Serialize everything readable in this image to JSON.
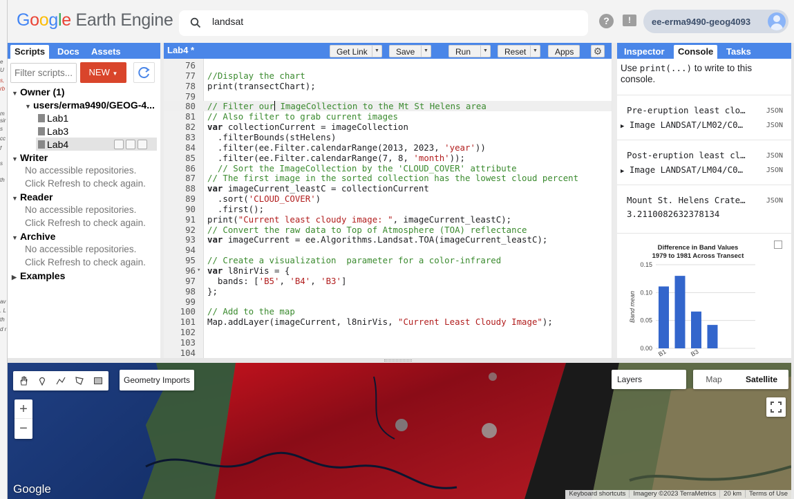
{
  "app": {
    "logo_google": [
      "G",
      "o",
      "o",
      "g",
      "l",
      "e"
    ],
    "logo_rest": "Earth Engine",
    "search_value": "landsat",
    "account": "ee-erma9490-geog4093",
    "help": "?",
    "feedback": "!"
  },
  "left": {
    "tabs": [
      "Scripts",
      "Docs",
      "Assets"
    ],
    "filter_placeholder": "Filter scripts...",
    "new_label": "NEW",
    "tree": {
      "owner": "Owner (1)",
      "repo": "users/erma9490/GEOG-4...",
      "files": [
        "Lab1",
        "Lab3",
        "Lab4"
      ],
      "writer": "Writer",
      "reader": "Reader",
      "archive": "Archive",
      "examples": "Examples",
      "no_repos": "No accessible repositories.",
      "refresh_hint": "Click Refresh to check again."
    }
  },
  "editor": {
    "title": "Lab4 *",
    "buttons": {
      "get_link": "Get Link",
      "save": "Save",
      "run": "Run",
      "reset": "Reset",
      "apps": "Apps"
    },
    "lines": [
      {
        "n": "76",
        "segs": []
      },
      {
        "n": "77",
        "segs": [
          {
            "c": "cm",
            "t": "//Display the chart"
          }
        ]
      },
      {
        "n": "78",
        "segs": [
          {
            "c": "",
            "t": "print(transectChart);"
          }
        ]
      },
      {
        "n": "79",
        "segs": []
      },
      {
        "n": "80",
        "active": true,
        "segs": [
          {
            "c": "cm",
            "t": "// Filter our"
          },
          {
            "c": "cursor",
            "t": ""
          },
          {
            "c": "cm",
            "t": " ImageCollection to the Mt St Helens area"
          }
        ]
      },
      {
        "n": "81",
        "segs": [
          {
            "c": "cm",
            "t": "// Also filter to grab current images"
          }
        ]
      },
      {
        "n": "82",
        "segs": [
          {
            "c": "kw",
            "t": "var"
          },
          {
            "c": "",
            "t": " collectionCurrent = imageCollection"
          }
        ]
      },
      {
        "n": "83",
        "segs": [
          {
            "c": "",
            "t": "  .filterBounds(stHelens)"
          }
        ]
      },
      {
        "n": "84",
        "segs": [
          {
            "c": "",
            "t": "  .filter(ee.Filter.calendarRange(2013, 2023, "
          },
          {
            "c": "st",
            "t": "'year'"
          },
          {
            "c": "",
            "t": "))"
          }
        ]
      },
      {
        "n": "85",
        "segs": [
          {
            "c": "",
            "t": "  .filter(ee.Filter.calendarRange(7, 8, "
          },
          {
            "c": "st",
            "t": "'month'"
          },
          {
            "c": "",
            "t": "));"
          }
        ]
      },
      {
        "n": "86",
        "segs": [
          {
            "c": "cm",
            "t": "  // Sort the ImageCollection by the 'CLOUD_COVER' attribute"
          }
        ]
      },
      {
        "n": "87",
        "segs": [
          {
            "c": "cm",
            "t": "// The first image in the sorted collection has the lowest cloud percent"
          }
        ]
      },
      {
        "n": "88",
        "segs": [
          {
            "c": "kw",
            "t": "var"
          },
          {
            "c": "",
            "t": " imageCurrent_leastC = collectionCurrent"
          }
        ]
      },
      {
        "n": "89",
        "segs": [
          {
            "c": "",
            "t": "  .sort("
          },
          {
            "c": "st",
            "t": "'CLOUD_COVER'"
          },
          {
            "c": "",
            "t": ")"
          }
        ]
      },
      {
        "n": "90",
        "segs": [
          {
            "c": "",
            "t": "  .first();"
          }
        ]
      },
      {
        "n": "91",
        "segs": [
          {
            "c": "",
            "t": "print("
          },
          {
            "c": "st",
            "t": "\"Current least cloudy image: \""
          },
          {
            "c": "",
            "t": ", imageCurrent_leastC);"
          }
        ]
      },
      {
        "n": "92",
        "segs": [
          {
            "c": "cm",
            "t": "// Convert the raw data to Top of Atmosphere (TOA) reflectance"
          }
        ]
      },
      {
        "n": "93",
        "segs": [
          {
            "c": "kw",
            "t": "var"
          },
          {
            "c": "",
            "t": " imageCurrent = ee.Algorithms.Landsat.TOA(imageCurrent_leastC);"
          }
        ]
      },
      {
        "n": "94",
        "segs": []
      },
      {
        "n": "95",
        "segs": [
          {
            "c": "cm",
            "t": "// Create a visualization  parameter for a color-infrared"
          }
        ]
      },
      {
        "n": "96",
        "fold": true,
        "segs": [
          {
            "c": "kw",
            "t": "var"
          },
          {
            "c": "",
            "t": " l8nirVis = {"
          }
        ]
      },
      {
        "n": "97",
        "segs": [
          {
            "c": "",
            "t": "  bands: ["
          },
          {
            "c": "st",
            "t": "'B5'"
          },
          {
            "c": "",
            "t": ", "
          },
          {
            "c": "st",
            "t": "'B4'"
          },
          {
            "c": "",
            "t": ", "
          },
          {
            "c": "st",
            "t": "'B3'"
          },
          {
            "c": "",
            "t": "]"
          }
        ]
      },
      {
        "n": "98",
        "segs": [
          {
            "c": "",
            "t": "};"
          }
        ]
      },
      {
        "n": "99",
        "segs": []
      },
      {
        "n": "100",
        "segs": [
          {
            "c": "cm",
            "t": "// Add to the map"
          }
        ]
      },
      {
        "n": "101",
        "segs": [
          {
            "c": "",
            "t": "Map.addLayer(imageCurrent, l8nirVis, "
          },
          {
            "c": "st",
            "t": "\"Current Least Cloudy Image\""
          },
          {
            "c": "",
            "t": ");"
          }
        ]
      },
      {
        "n": "102",
        "segs": []
      },
      {
        "n": "103",
        "segs": []
      },
      {
        "n": "104",
        "segs": []
      }
    ]
  },
  "right": {
    "tabs": [
      "Inspector",
      "Console",
      "Tasks"
    ],
    "intro_pre": "Use ",
    "intro_code": "print(...)",
    "intro_post": " to write to this console.",
    "outputs": [
      {
        "line1": "Pre-eruption least clo…",
        "line2": "Image LANDSAT/LM02/C0…",
        "tag": "JSON"
      },
      {
        "line1": "Post-eruption least cl…",
        "line2": "Image LANDSAT/LM04/C0…",
        "tag": "JSON"
      },
      {
        "line1": "Mount St. Helens Crate…",
        "line2": "3.2110082632378134",
        "tag": "JSON",
        "value_only": true
      }
    ]
  },
  "chart_data": {
    "type": "bar",
    "title": "Difference in Band Values 1979 to 1981 Across Transect",
    "ylabel": "Band mean",
    "xlabel": "",
    "ylim": [
      0,
      0.15
    ],
    "yticks": [
      "0.15",
      "0.10",
      "0.05",
      "0.00"
    ],
    "xtick_fragments": [
      "B1",
      "B3"
    ],
    "values": [
      0.111,
      0.13,
      0.066,
      0.042
    ],
    "bar_color": "#3366cc"
  },
  "map": {
    "geometry_imports": "Geometry Imports",
    "layers": "Layers",
    "map_type": "Map",
    "satellite_type": "Satellite",
    "zoom_in": "+",
    "zoom_out": "−",
    "google": "Google",
    "attribution": [
      "Keyboard shortcuts",
      "Imagery ©2023 TerraMetrics",
      "20 km",
      "Terms of Use"
    ]
  }
}
